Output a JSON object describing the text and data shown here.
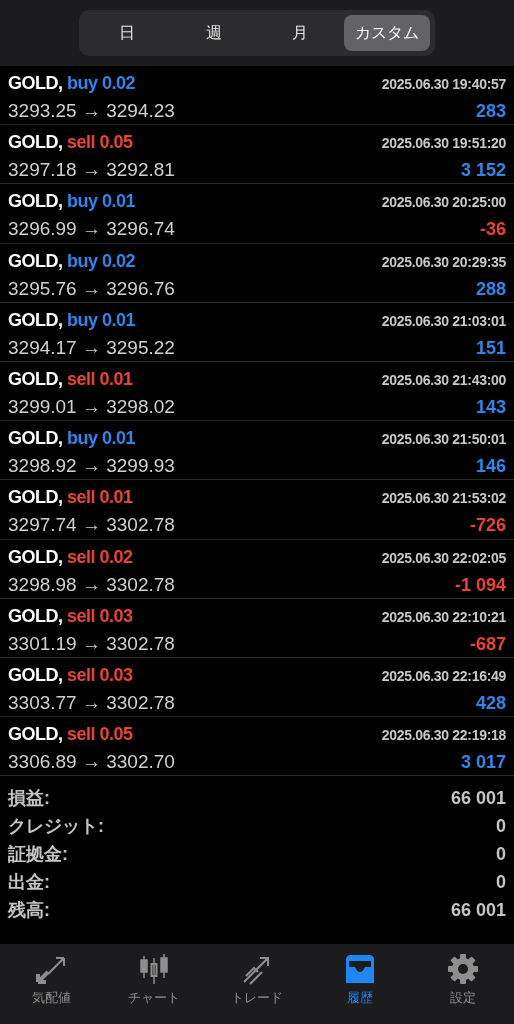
{
  "period_tabs": [
    {
      "label": "日",
      "selected": false
    },
    {
      "label": "週",
      "selected": false
    },
    {
      "label": "月",
      "selected": false
    },
    {
      "label": "カスタム",
      "selected": true
    }
  ],
  "trades": [
    {
      "symbol": "GOLD,",
      "kind": "buy",
      "order": "buy 0.02",
      "time": "2025.06.30 19:40:57",
      "prices": "3293.25 → 3294.23",
      "color": "#2f86ea",
      "profit": "283"
    },
    {
      "symbol": "GOLD,",
      "kind": "sell",
      "order": "sell 0.05",
      "time": "2025.06.30 19:51:20",
      "prices": "3297.18 → 3292.81",
      "color": "#2f86ea",
      "profit": "3 152"
    },
    {
      "symbol": "GOLD,",
      "kind": "buy",
      "order": "buy 0.01",
      "time": "2025.06.30 20:25:00",
      "prices": "3296.99 → 3296.74",
      "color": "#ea4336",
      "profit": "-36"
    },
    {
      "symbol": "GOLD,",
      "kind": "buy",
      "order": "buy 0.02",
      "time": "2025.06.30 20:29:35",
      "prices": "3295.76 → 3296.76",
      "color": "#2f86ea",
      "profit": "288"
    },
    {
      "symbol": "GOLD,",
      "kind": "buy",
      "order": "buy 0.01",
      "time": "2025.06.30 21:03:01",
      "prices": "3294.17 → 3295.22",
      "color": "#2f86ea",
      "profit": "151"
    },
    {
      "symbol": "GOLD,",
      "kind": "sell",
      "order": "sell 0.01",
      "time": "2025.06.30 21:43:00",
      "prices": "3299.01 → 3298.02",
      "color": "#2f86ea",
      "profit": "143"
    },
    {
      "symbol": "GOLD,",
      "kind": "buy",
      "order": "buy 0.01",
      "time": "2025.06.30 21:50:01",
      "prices": "3298.92 → 3299.93",
      "color": "#2f86ea",
      "profit": "146"
    },
    {
      "symbol": "GOLD,",
      "kind": "sell",
      "order": "sell 0.01",
      "time": "2025.06.30 21:53:02",
      "prices": "3297.74 → 3302.78",
      "color": "#ea4336",
      "profit": "-726"
    },
    {
      "symbol": "GOLD,",
      "kind": "sell",
      "order": "sell 0.02",
      "time": "2025.06.30 22:02:05",
      "prices": "3298.98 → 3302.78",
      "color": "#ea4336",
      "profit": "-1 094"
    },
    {
      "symbol": "GOLD,",
      "kind": "sell",
      "order": "sell 0.03",
      "time": "2025.06.30 22:10:21",
      "prices": "3301.19 → 3302.78",
      "color": "#ea4336",
      "profit": "-687"
    },
    {
      "symbol": "GOLD,",
      "kind": "sell",
      "order": "sell 0.03",
      "time": "2025.06.30 22:16:49",
      "prices": "3303.77 → 3302.78",
      "color": "#2f86ea",
      "profit": "428"
    },
    {
      "symbol": "GOLD,",
      "kind": "sell",
      "order": "sell 0.05",
      "time": "2025.06.30 22:19:18",
      "prices": "3306.89 → 3302.70",
      "color": "#2f86ea",
      "profit": "3 017"
    }
  ],
  "summary": [
    {
      "label": "損益:",
      "value": "66 001"
    },
    {
      "label": "クレジット:",
      "value": "0"
    },
    {
      "label": "証拠金:",
      "value": "0"
    },
    {
      "label": "出金:",
      "value": "0"
    },
    {
      "label": "残高:",
      "value": "66 001"
    }
  ],
  "tab_bar": [
    {
      "kind": "quotes",
      "label": "気配値",
      "selected": false
    },
    {
      "kind": "chart",
      "label": "チャート",
      "selected": false
    },
    {
      "kind": "trade",
      "label": "トレード",
      "selected": false
    },
    {
      "kind": "history",
      "label": "履歴",
      "selected": true
    },
    {
      "kind": "settings",
      "label": "設定",
      "selected": false
    }
  ]
}
